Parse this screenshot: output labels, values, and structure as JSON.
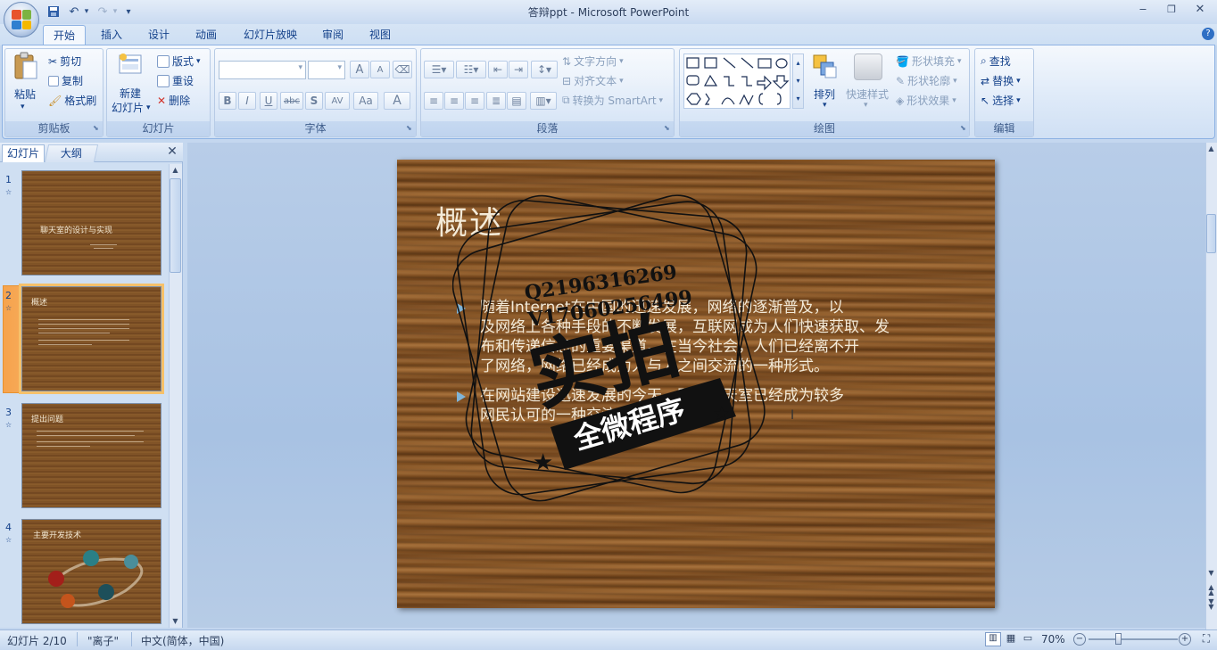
{
  "window": {
    "title": "答辩ppt - Microsoft PowerPoint",
    "help": "?"
  },
  "quick_access": {
    "save_icon": "save-icon",
    "undo_icon": "undo-icon",
    "redo_icon": "redo-icon"
  },
  "tabs": [
    "开始",
    "插入",
    "设计",
    "动画",
    "幻灯片放映",
    "审阅",
    "视图"
  ],
  "ribbon": {
    "clipboard": {
      "label": "剪贴板",
      "paste": "粘贴",
      "cut": "剪切",
      "copy": "复制",
      "format_painter": "格式刷"
    },
    "slides": {
      "label": "幻灯片",
      "new_slide_1": "新建",
      "new_slide_2": "幻灯片",
      "layout": "版式",
      "reset": "重设",
      "delete": "删除"
    },
    "font": {
      "label": "字体",
      "bold": "B",
      "italic": "I",
      "underline": "U",
      "strike": "abc",
      "shadow": "S",
      "spacing": "AV",
      "case": "Aa",
      "color": "A",
      "grow": "A",
      "shrink": "A"
    },
    "paragraph": {
      "label": "段落",
      "text_direction": "文字方向",
      "align_text": "对齐文本",
      "smartart": "转换为 SmartArt"
    },
    "drawing": {
      "label": "绘图",
      "arrange": "排列",
      "quick_styles": "快速样式",
      "fill": "形状填充",
      "outline": "形状轮廓",
      "effects": "形状效果"
    },
    "editing": {
      "label": "编辑",
      "find": "查找",
      "replace": "替换",
      "select": "选择"
    }
  },
  "pane": {
    "tab_slides": "幻灯片",
    "tab_outline": "大纲",
    "thumbnails": [
      {
        "num": "1",
        "title": "聊天室的设计与实现"
      },
      {
        "num": "2",
        "title": "概述"
      },
      {
        "num": "3",
        "title": "提出问题"
      },
      {
        "num": "4",
        "title": "主要开发技术"
      }
    ]
  },
  "slide": {
    "title": "概述",
    "bullets": [
      [
        "随着Internet在中国的迅速发展，网络的逐渐普及，以",
        "及网络上各种手段的不断发展，互联网成为人们快速获取、发",
        "布和传递信息的重要渠道。在当今社会，人们已经离不开",
        "了网络，网络已经成为人与人之间交流的一种形式。"
      ],
      [
        "在网站建设迅速发展的今天，网络聊天室已经成为较多",
        "网民认可的一种交流平台。"
      ]
    ],
    "watermark": {
      "line1": "Q2196316269",
      "line2": "V17060256499",
      "big": "实拍",
      "banner": "全微程序"
    }
  },
  "status": {
    "slide_info": "幻灯片 2/10",
    "theme": "\"离子\"",
    "language": "中文(简体，中国)",
    "zoom": "70%"
  }
}
